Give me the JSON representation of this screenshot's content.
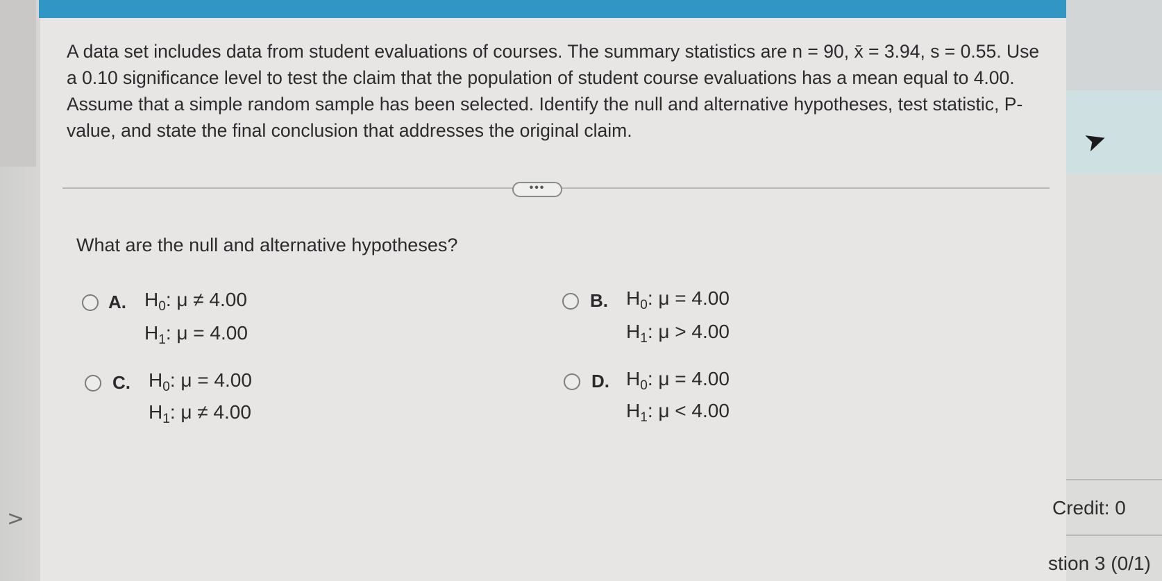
{
  "problem_text": "A data set includes data from student evaluations of courses. The summary statistics are n = 90, x̄ = 3.94, s = 0.55. Use a 0.10 significance level to test the claim that the population of student course evaluations has a mean equal to 4.00. Assume that a simple random sample has been selected. Identify the null and alternative hypotheses, test statistic, P-value, and state the final conclusion that addresses the original claim.",
  "more_button": "•••",
  "question": "What are the null and alternative hypotheses?",
  "options": [
    {
      "letter": "A.",
      "h0_label": "H",
      "h0_sub": "0",
      "h0_rel": ": μ ≠ 4.00",
      "h1_label": "H",
      "h1_sub": "1",
      "h1_rel": ": μ = 4.00"
    },
    {
      "letter": "B.",
      "h0_label": "H",
      "h0_sub": "0",
      "h0_rel": ": μ = 4.00",
      "h1_label": "H",
      "h1_sub": "1",
      "h1_rel": ": μ > 4.00"
    },
    {
      "letter": "C.",
      "h0_label": "H",
      "h0_sub": "0",
      "h0_rel": ": μ = 4.00",
      "h1_label": "H",
      "h1_sub": "1",
      "h1_rel": ": μ ≠ 4.00"
    },
    {
      "letter": "D.",
      "h0_label": "H",
      "h0_sub": "0",
      "h0_rel": ": μ = 4.00",
      "h1_label": "H",
      "h1_sub": "1",
      "h1_rel": ": μ < 4.00"
    }
  ],
  "credit": "Credit: 0",
  "question_status": "stion 3 (0/1)",
  "nav": {
    "chevron": ">"
  },
  "colors": {
    "top_bar": "#3296c4",
    "panel": "#e7e6e4"
  }
}
